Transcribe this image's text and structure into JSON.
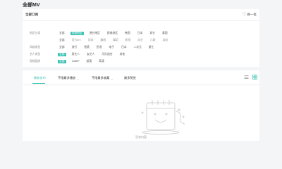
{
  "page": {
    "title": "全部MV"
  },
  "filter": {
    "header_title": "全部订阅",
    "shuffle_label": "换一批",
    "rows": [
      {
        "label": "地区分类",
        "options": [
          {
            "text": "全部",
            "active": false
          },
          {
            "text": "内地地区",
            "active": true
          },
          {
            "text": "港台地区",
            "active": false
          },
          {
            "text": "欧美地区",
            "active": false
          },
          {
            "text": "韩国",
            "active": false
          },
          {
            "text": "日本",
            "active": false
          },
          {
            "text": "其它",
            "active": false
          },
          {
            "text": "泰国",
            "active": false
          }
        ]
      },
      {
        "label": "",
        "options": [
          {
            "text": "全部",
            "active": false
          },
          {
            "text": "官方MV",
            "active": true
          },
          {
            "text": "现场",
            "active": false
          },
          {
            "text": "翻唱",
            "active": false
          },
          {
            "text": "舞蹈",
            "active": false
          },
          {
            "text": "影视",
            "active": false
          },
          {
            "text": "综艺",
            "active": false
          },
          {
            "text": "儿歌",
            "active": false
          },
          {
            "text": "游戏",
            "active": false
          }
        ]
      },
      {
        "label": "风格类型",
        "options": [
          {
            "text": "全部",
            "active": false
          },
          {
            "text": "流行",
            "active": false
          },
          {
            "text": "摇滚",
            "active": false
          },
          {
            "text": "民谣",
            "active": false
          },
          {
            "text": "电子",
            "active": false
          },
          {
            "text": "日本",
            "active": false
          },
          {
            "text": "二次元",
            "active": false
          },
          {
            "text": "爵士",
            "active": false
          }
        ]
      },
      {
        "label": "艺人类型",
        "options": [
          {
            "text": "全部",
            "active": true
          },
          {
            "text": "男艺人",
            "active": false
          },
          {
            "text": "女艺人",
            "active": false
          },
          {
            "text": "乐队组合",
            "active": false
          },
          {
            "text": "其他",
            "active": false
          }
        ]
      },
      {
        "label": "视频画质",
        "options": [
          {
            "text": "全部",
            "active": true
          },
          {
            "text": "1080P",
            "active": false
          },
          {
            "text": "超清",
            "active": false
          },
          {
            "text": "高清",
            "active": false
          }
        ]
      }
    ]
  },
  "toolbar": {
    "tab_newest": "最新发布",
    "dropdown1": "不限最多播放",
    "dropdown2": "不限最多收藏",
    "dropdown3": "最多赞赏"
  },
  "empty": {
    "text": "没有内容"
  },
  "colors": {
    "accent": "#3fc3b5",
    "background": "#f4f5f7"
  }
}
